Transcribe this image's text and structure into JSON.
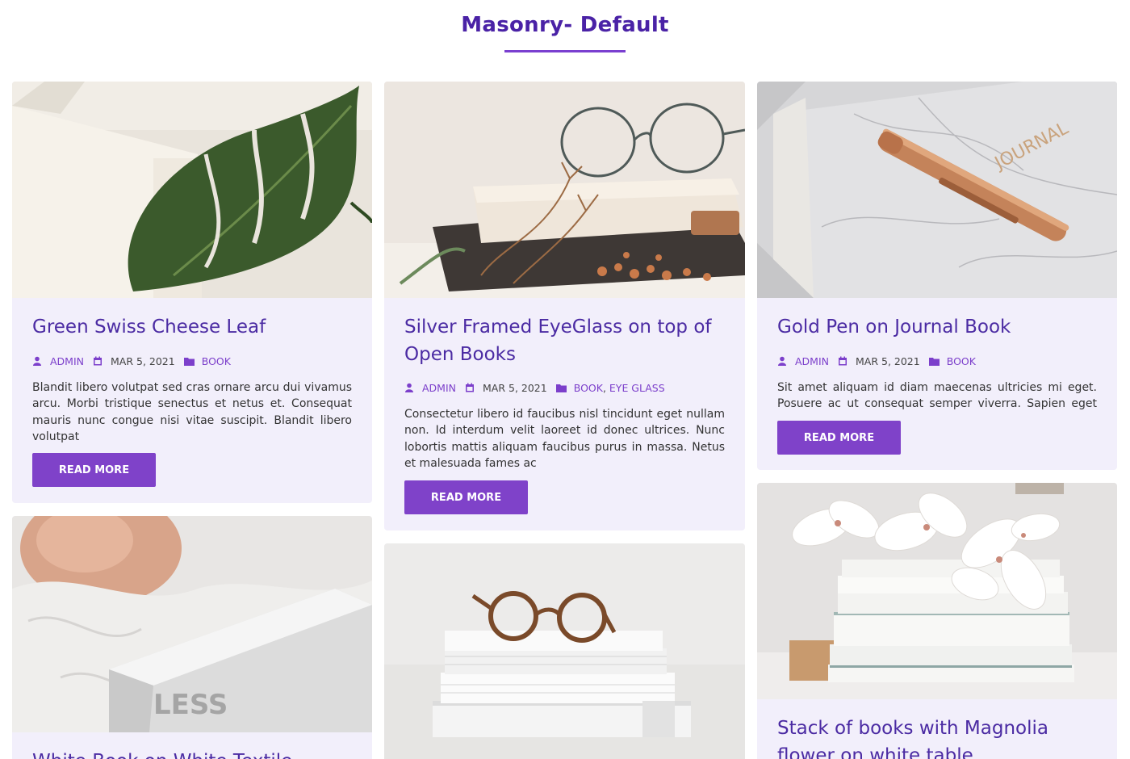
{
  "page": {
    "title": "Masonry- Default",
    "accent_color": "#7f42c9",
    "title_color": "#4a22a6",
    "card_bg": "#f2effb"
  },
  "posts": [
    {
      "title": "Green Swiss Cheese Leaf",
      "author": "ADMIN",
      "date": "MAR 5, 2021",
      "categories": [
        "BOOK"
      ],
      "excerpt": "Blandit libero volutpat sed cras ornare arcu dui vivamus arcu. Morbi tristique senectus et netus et. Consequat mauris nunc congue nisi vitae suscipit. Blandit libero volutpat",
      "button": "READ MORE",
      "image": "monstera-leaf-on-open-book"
    },
    {
      "title": "Silver Framed EyeGlass on top of Open Books",
      "author": "ADMIN",
      "date": "MAR 5, 2021",
      "categories": [
        "BOOK",
        "EYE GLASS"
      ],
      "excerpt": "Consectetur libero id faucibus nisl tincidunt eget nullam non. Id interdum velit laoreet id donec ultrices. Nunc lobortis mattis aliquam faucibus purus in massa. Netus et malesuada fames ac",
      "button": "READ MORE",
      "image": "eyeglasses-on-books-with-dried-flowers"
    },
    {
      "title": "Gold Pen on Journal Book",
      "author": "ADMIN",
      "date": "MAR 5, 2021",
      "categories": [
        "BOOK"
      ],
      "excerpt": "Sit amet aliquam id diam maecenas ultricies mi eget. Posuere ac ut consequat semper viverra. Sapien eget mi",
      "button": "READ MORE",
      "image": "gold-pen-on-marble-journal",
      "image_text": "JOURNAL"
    },
    {
      "title": "White Book on White Textile",
      "image": "white-book-on-textile",
      "image_text": "LESS"
    },
    {
      "title": "",
      "image": "tortoise-glasses-on-book-stack"
    },
    {
      "title": "Stack of books with Magnolia flower on white table",
      "image": "magnolia-on-book-stack"
    }
  ]
}
